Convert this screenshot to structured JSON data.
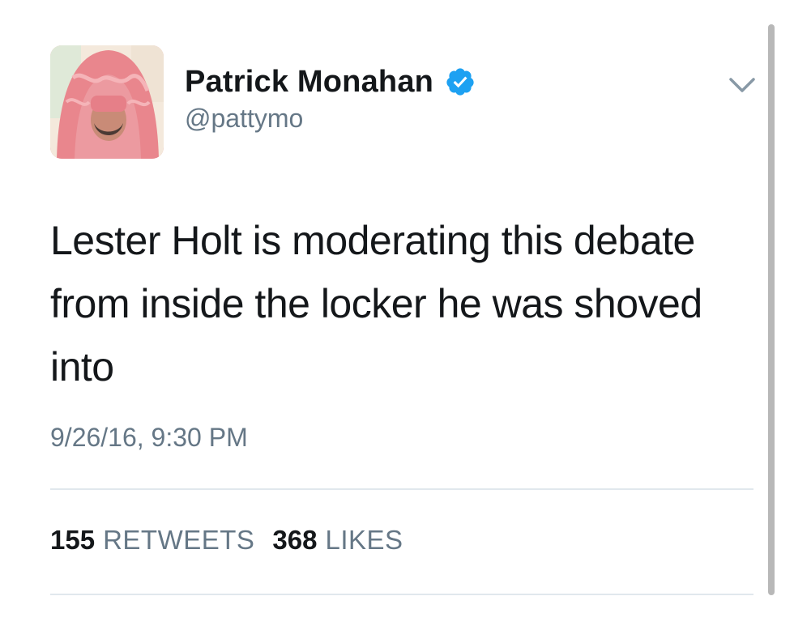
{
  "tweet": {
    "author": {
      "display_name": "Patrick Monahan",
      "handle": "@pattymo",
      "verified": true,
      "avatar_icon": "hooded-person-avatar"
    },
    "text": "Lester Holt is moderating this debate from inside the locker he was shoved into",
    "timestamp": "9/26/16, 9:30 PM",
    "stats": {
      "retweets_count": "155",
      "retweets_label": "RETWEETS",
      "likes_count": "368",
      "likes_label": "LIKES"
    },
    "menu_icon": "chevron-down-icon"
  },
  "colors": {
    "text_primary": "#14171a",
    "text_secondary": "#657786",
    "verified_blue": "#1da1f2",
    "divider": "#e1e8ed",
    "avatar_pink": "#e98f94"
  }
}
